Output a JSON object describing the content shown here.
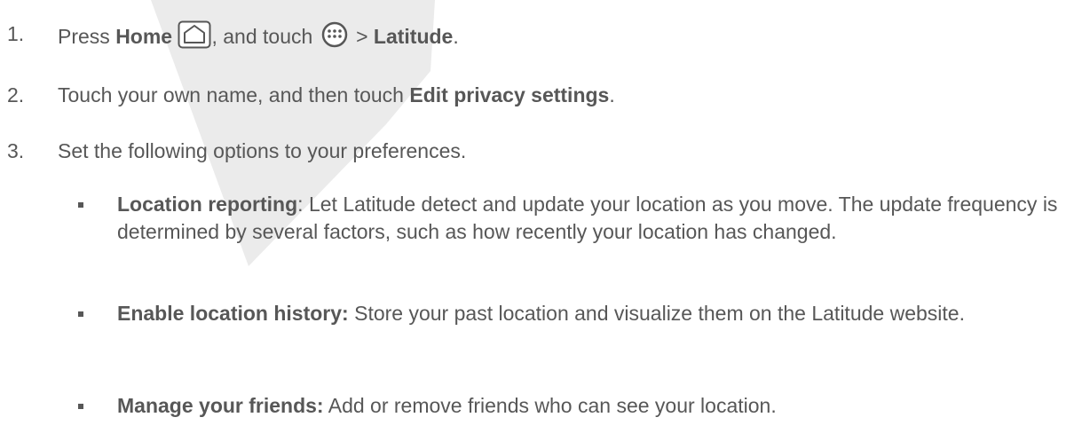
{
  "steps": [
    {
      "number": "1.",
      "prefix": "Press ",
      "home_label": "Home",
      "mid": ", and touch",
      "arrow": " > ",
      "latitude_label": "Latitude",
      "end": ".",
      "icons": [
        "home-icon",
        "apps-icon"
      ]
    },
    {
      "number": "2.",
      "prefix": "Touch your own name, and then touch ",
      "bold": "Edit privacy settings",
      "end": "."
    },
    {
      "number": "3.",
      "text": "Set the following options to your preferences."
    }
  ],
  "options": [
    {
      "label": "Location reporting",
      "sep": ": ",
      "text": "Let Latitude detect and update your location as you move. The update frequency is determined by several factors, such as how recently your location has changed."
    },
    {
      "label": "Enable location history:",
      "sep": " ",
      "text": "Store your past location and visualize them on the Latitude website."
    },
    {
      "label": "Manage your friends:",
      "sep": " ",
      "text": "Add or remove friends who can see your location."
    }
  ],
  "colors": {
    "text": "#575757",
    "watermark": "#e6e6e6"
  }
}
